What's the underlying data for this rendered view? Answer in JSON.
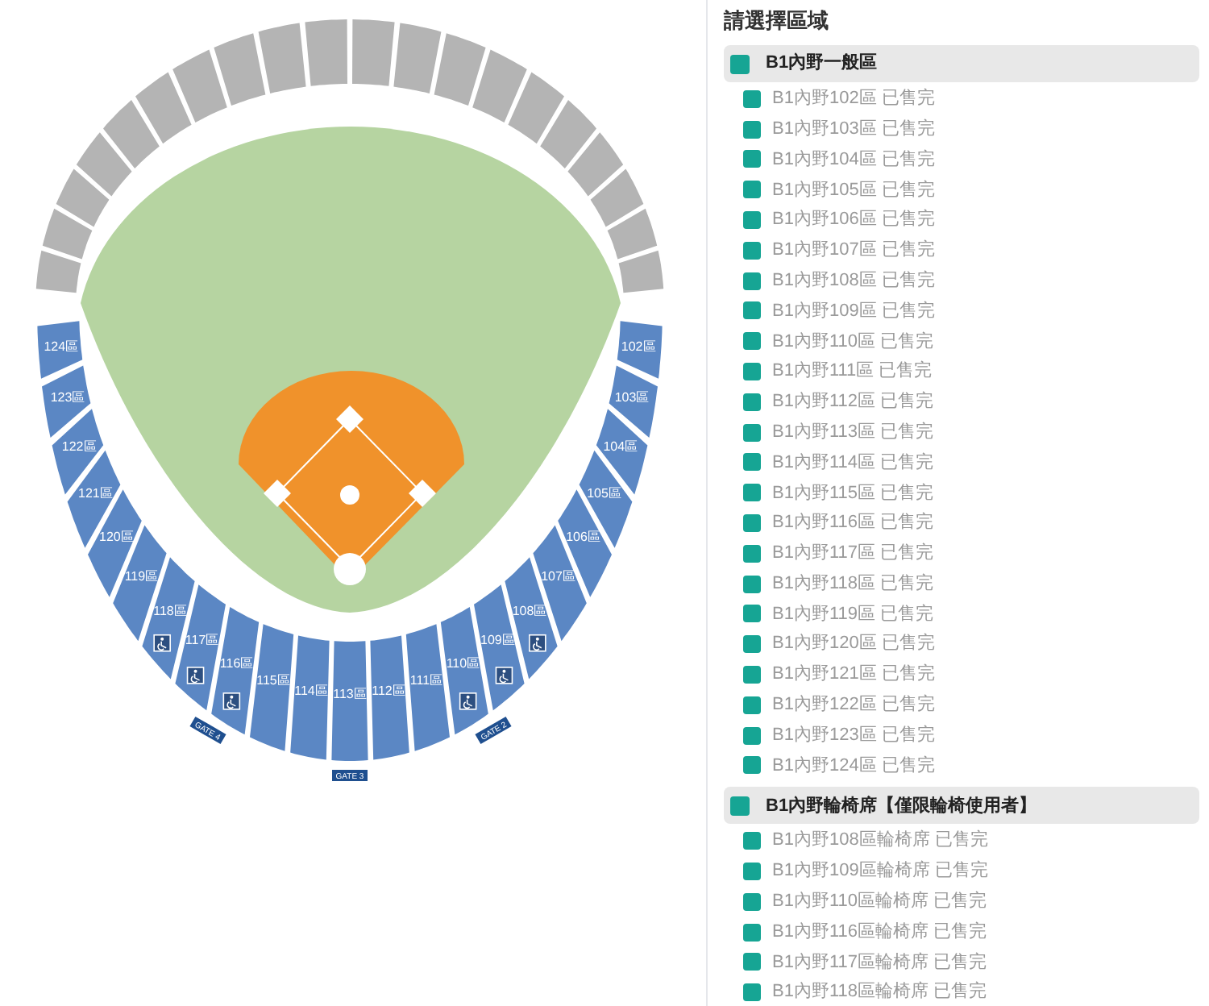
{
  "stadium": {
    "sections": [
      {
        "label": "124區",
        "wheelchair": false
      },
      {
        "label": "123區",
        "wheelchair": false
      },
      {
        "label": "122區",
        "wheelchair": false
      },
      {
        "label": "121區",
        "wheelchair": false
      },
      {
        "label": "120區",
        "wheelchair": false
      },
      {
        "label": "119區",
        "wheelchair": false
      },
      {
        "label": "118區",
        "wheelchair": true
      },
      {
        "label": "117區",
        "wheelchair": true
      },
      {
        "label": "116區",
        "wheelchair": true
      },
      {
        "label": "115區",
        "wheelchair": false
      },
      {
        "label": "114區",
        "wheelchair": false
      },
      {
        "label": "113區",
        "wheelchair": false
      },
      {
        "label": "112區",
        "wheelchair": false
      },
      {
        "label": "111區",
        "wheelchair": false
      },
      {
        "label": "110區",
        "wheelchair": true
      },
      {
        "label": "109區",
        "wheelchair": true
      },
      {
        "label": "108區",
        "wheelchair": true
      },
      {
        "label": "107區",
        "wheelchair": false
      },
      {
        "label": "106區",
        "wheelchair": false
      },
      {
        "label": "105區",
        "wheelchair": false
      },
      {
        "label": "104區",
        "wheelchair": false
      },
      {
        "label": "103區",
        "wheelchair": false
      },
      {
        "label": "102區",
        "wheelchair": false
      }
    ],
    "gates": [
      "GATE 4",
      "GATE 3",
      "GATE 2"
    ]
  },
  "panel": {
    "title": "請選擇區域",
    "groups": [
      {
        "name": "B1內野一般區",
        "items": [
          {
            "label": "B1內野102區 已售完",
            "disabled": true
          },
          {
            "label": "B1內野103區 已售完",
            "disabled": true
          },
          {
            "label": "B1內野104區 已售完",
            "disabled": true
          },
          {
            "label": "B1內野105區 已售完",
            "disabled": true
          },
          {
            "label": "B1內野106區 已售完",
            "disabled": true
          },
          {
            "label": "B1內野107區 已售完",
            "disabled": true
          },
          {
            "label": "B1內野108區 已售完",
            "disabled": true
          },
          {
            "label": "B1內野109區 已售完",
            "disabled": true
          },
          {
            "label": "B1內野110區 已售完",
            "disabled": true
          },
          {
            "label": "B1內野111區 已售完",
            "disabled": true
          },
          {
            "label": "B1內野112區 已售完",
            "disabled": true
          },
          {
            "label": "B1內野113區 已售完",
            "disabled": true
          },
          {
            "label": "B1內野114區 已售完",
            "disabled": true
          },
          {
            "label": "B1內野115區 已售完",
            "disabled": true
          },
          {
            "label": "B1內野116區 已售完",
            "disabled": true
          },
          {
            "label": "B1內野117區 已售完",
            "disabled": true
          },
          {
            "label": "B1內野118區 已售完",
            "disabled": true
          },
          {
            "label": "B1內野119區 已售完",
            "disabled": true
          },
          {
            "label": "B1內野120區 已售完",
            "disabled": true
          },
          {
            "label": "B1內野121區 已售完",
            "disabled": true
          },
          {
            "label": "B1內野122區 已售完",
            "disabled": true
          },
          {
            "label": "B1內野123區 已售完",
            "disabled": true
          },
          {
            "label": "B1內野124區 已售完",
            "disabled": true
          }
        ]
      },
      {
        "name": "B1內野輪椅席【僅限輪椅使用者】",
        "items": [
          {
            "label": "B1內野108區輪椅席 已售完",
            "disabled": true
          },
          {
            "label": "B1內野109區輪椅席 已售完",
            "disabled": true
          },
          {
            "label": "B1內野110區輪椅席 已售完",
            "disabled": true
          },
          {
            "label": "B1內野116區輪椅席 已售完",
            "disabled": true
          },
          {
            "label": "B1內野117區輪椅席 已售完",
            "disabled": true
          },
          {
            "label": "B1內野118區輪椅席 已售完",
            "disabled": true
          }
        ]
      }
    ]
  }
}
